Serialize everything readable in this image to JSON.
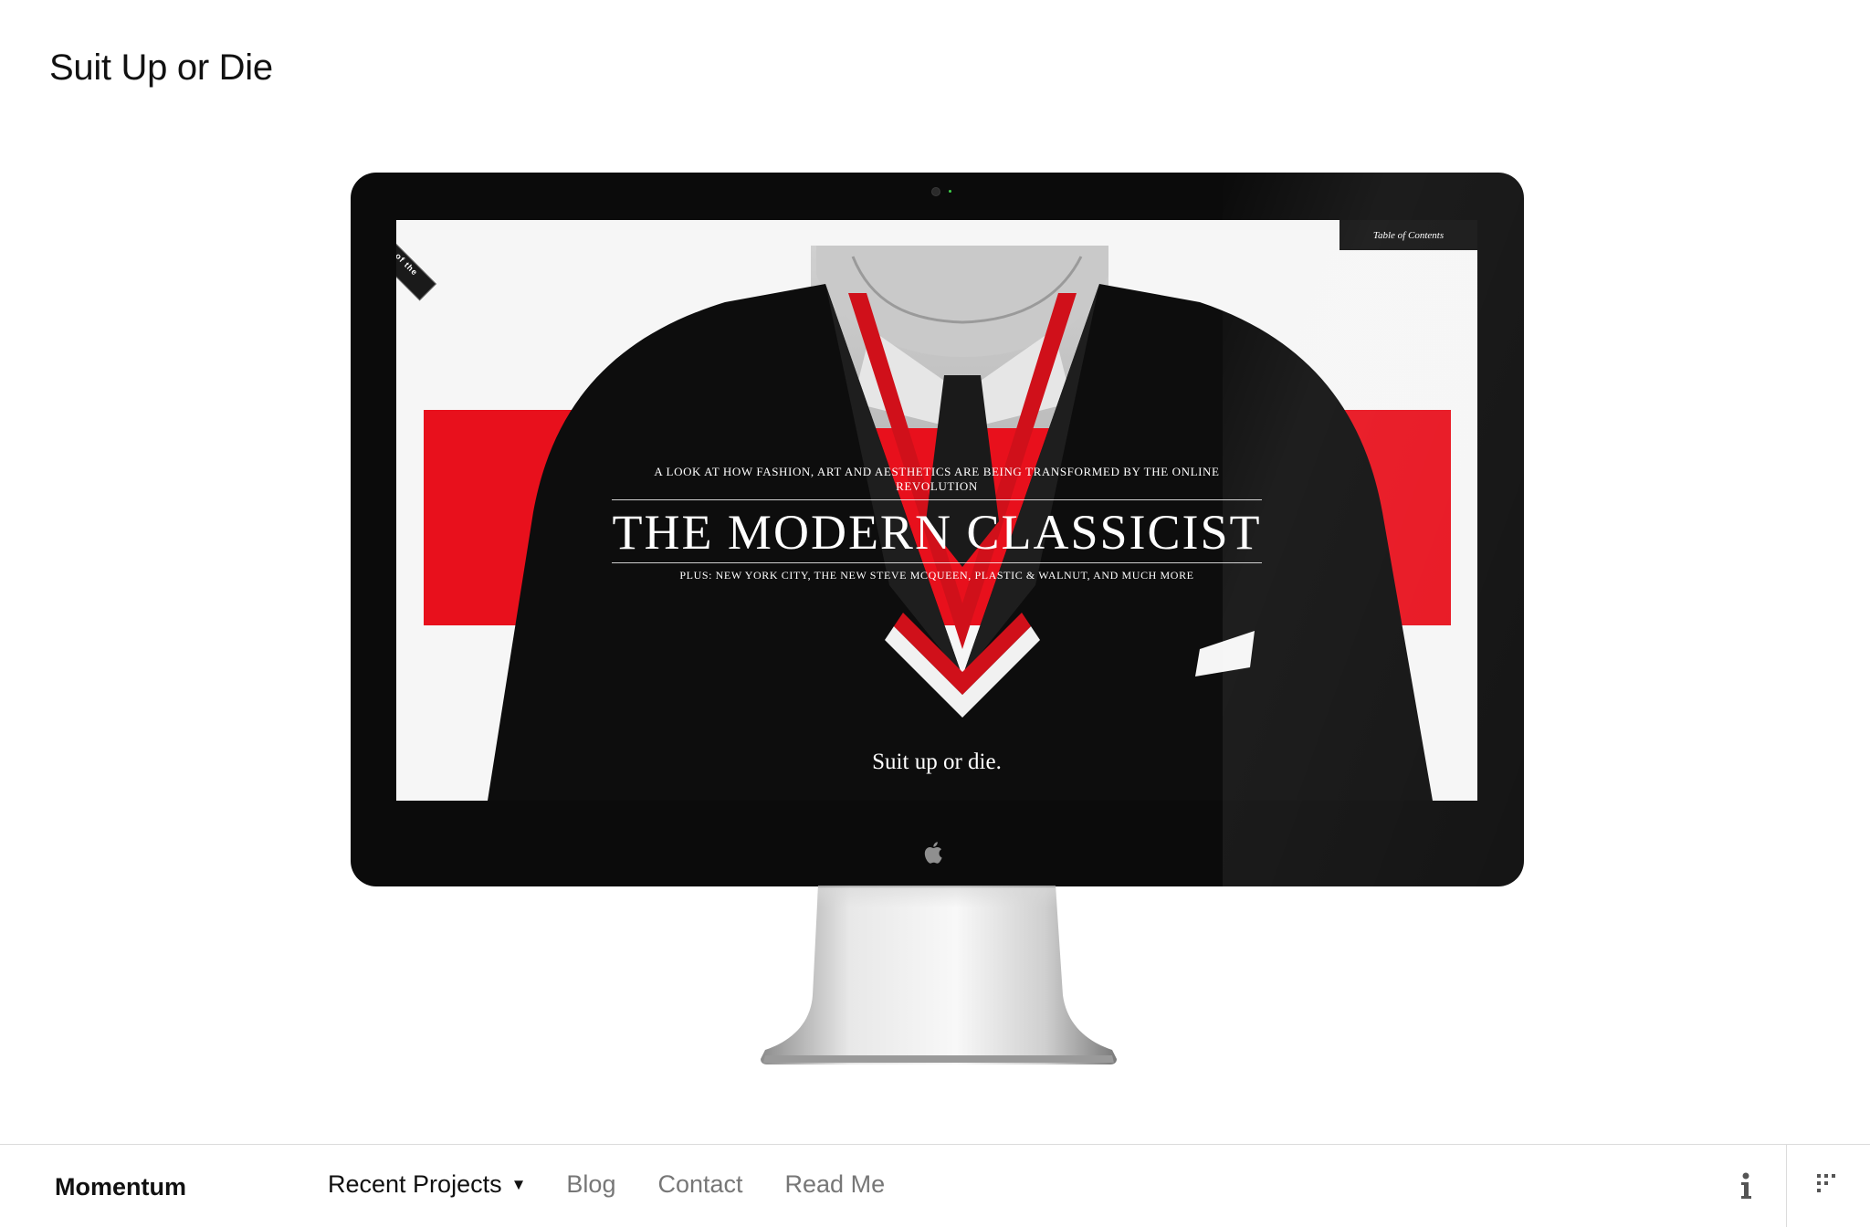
{
  "page": {
    "title": "Suit Up or Die"
  },
  "screen_content": {
    "badge": "SITE of the DAY",
    "toc_label": "Table of Contents",
    "kicker": "A LOOK AT HOW FASHION, ART AND AESTHETICS ARE BEING TRANSFORMED BY THE ONLINE REVOLUTION",
    "headline": "THE MODERN CLASSICIST",
    "subline": "PLUS: NEW YORK CITY, THE NEW STEVE MCQUEEN, PLASTIC & WALNUT, AND MUCH MORE",
    "tagline": "Suit up or die.",
    "accent_color": "#e8101c"
  },
  "bottom_bar": {
    "brand": "Momentum",
    "nav": [
      {
        "label": "Recent Projects",
        "caret": "▼"
      },
      {
        "label": "Blog"
      },
      {
        "label": "Contact"
      },
      {
        "label": "Read Me"
      }
    ],
    "icons": {
      "info": "info-icon",
      "grid": "grid-icon"
    }
  }
}
